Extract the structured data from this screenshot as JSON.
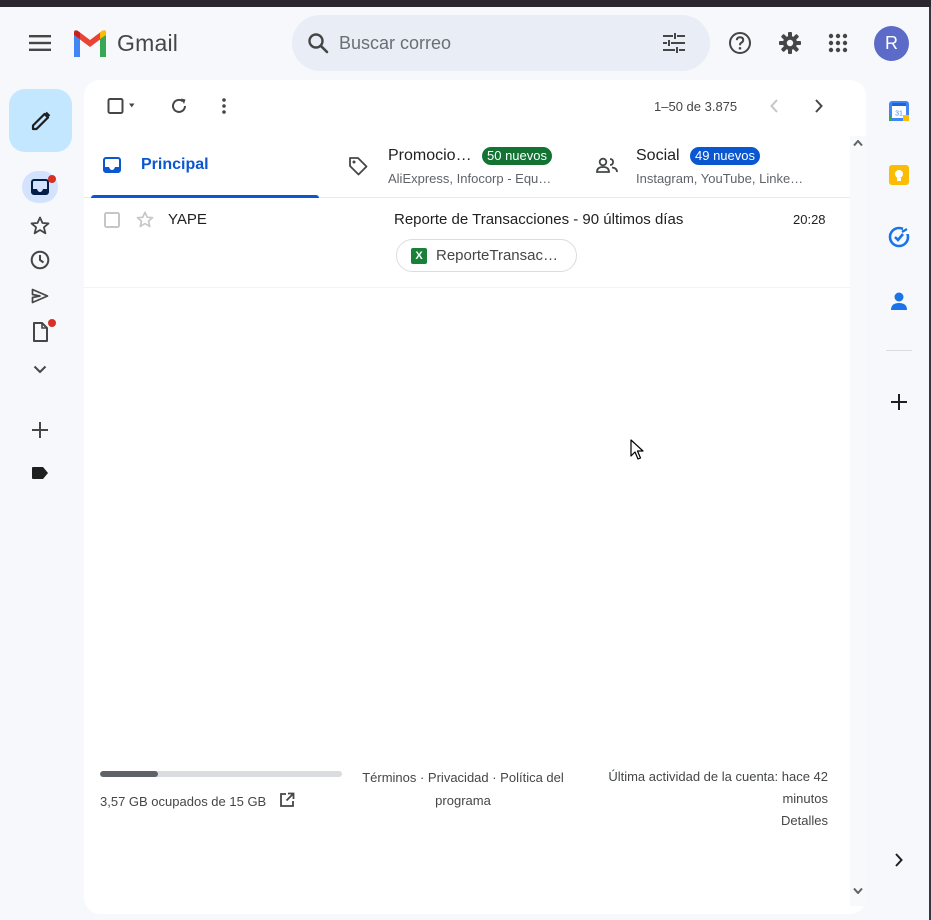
{
  "header": {
    "app_name": "Gmail",
    "search_placeholder": "Buscar correo",
    "avatar_initial": "R",
    "brand_colors": {
      "red": "#ea4335",
      "blue": "#4285f4",
      "green": "#34a853",
      "yellow": "#fbbc04"
    }
  },
  "toolbar": {
    "pagination": "1–50 de 3.875"
  },
  "tabs": [
    {
      "name": "Principal",
      "active": true
    },
    {
      "name": "Promocio…",
      "badge": "50 nuevos",
      "badge_color": "#137333",
      "subtitle": "AliExpress, Infocorp - Equ…"
    },
    {
      "name": "Social",
      "badge": "49 nuevos",
      "badge_color": "#0b57d0",
      "subtitle": "Instagram, YouTube, Linke…"
    }
  ],
  "emails": [
    {
      "sender": "YAPE",
      "subject": "Reporte de Transacciones - 90 últimos días",
      "time": "20:28",
      "attachment": {
        "type": "xls-icon",
        "label": "X",
        "name": "ReporteTransac…"
      }
    }
  ],
  "footer": {
    "storage_used_fraction": 0.238,
    "storage_text": "3,57 GB ocupados de 15 GB",
    "links_line1": "Términos · Privacidad · Política del",
    "links_line2": "programa",
    "activity_line1": "Última actividad de la cuenta: hace 42",
    "activity_line2": "minutos",
    "details": "Detalles"
  },
  "left_rail_icons": [
    "pencil-icon",
    "inbox-icon",
    "star-icon",
    "clock-icon",
    "send-icon",
    "draft-icon",
    "chevron-down-icon",
    "plus-icon",
    "label-icon"
  ],
  "right_rail_icons": [
    "calendar-icon",
    "keep-icon",
    "tasks-icon",
    "contacts-icon",
    "plus-icon",
    "chevron-right-icon"
  ]
}
